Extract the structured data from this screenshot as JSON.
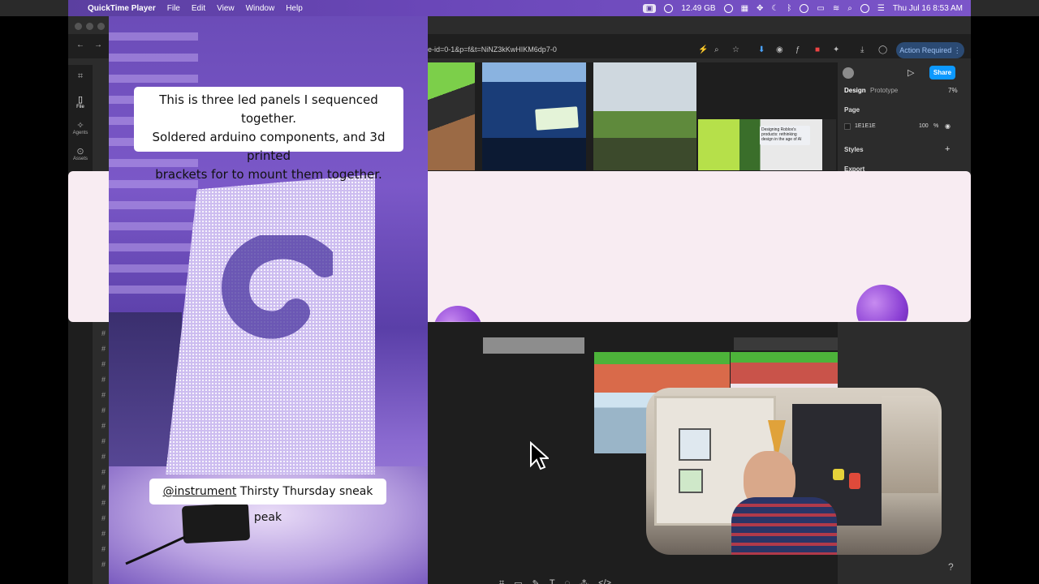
{
  "menubar": {
    "app_name": "QuickTime Player",
    "menus": [
      "File",
      "Edit",
      "View",
      "Window",
      "Help"
    ],
    "memory": "12.49 GB",
    "datetime": "Thu Jul 16  8:53 AM"
  },
  "browser": {
    "url": "e-id=0-1&p=f&t=NiNZ3kKwHIKM6dp7-0",
    "action_button": "Action Required"
  },
  "figma": {
    "rail": [
      {
        "label": "File",
        "icon": "file-icon"
      },
      {
        "label": "Agents",
        "icon": "agents-icon"
      },
      {
        "label": "Assets",
        "icon": "assets-icon"
      }
    ],
    "tabs": {
      "design": "Design",
      "prototype": "Prototype"
    },
    "zoom": "7%",
    "share": "Share",
    "page_section": "Page",
    "page_color": "1E1E1E",
    "page_opacity": "100",
    "page_opacity_unit": "%",
    "styles_section": "Styles",
    "export_section": "Export",
    "stage_slide_text": "Designing Roblox's products: rethinking design in the age of AI",
    "colors": {
      "banner": "#f8ecf2",
      "accent": "#0d99ff",
      "orb": "#8a3fd4"
    }
  },
  "reel": {
    "caption_top": [
      "This is three led panels I sequenced together.",
      "Soldered arduino components, and 3d printed",
      "brackets for to mount them together."
    ],
    "caption_mention": "@instrument",
    "caption_bottom_rest": " Thirsty Thursday sneak peak"
  },
  "toolbar": {
    "help": "?"
  }
}
